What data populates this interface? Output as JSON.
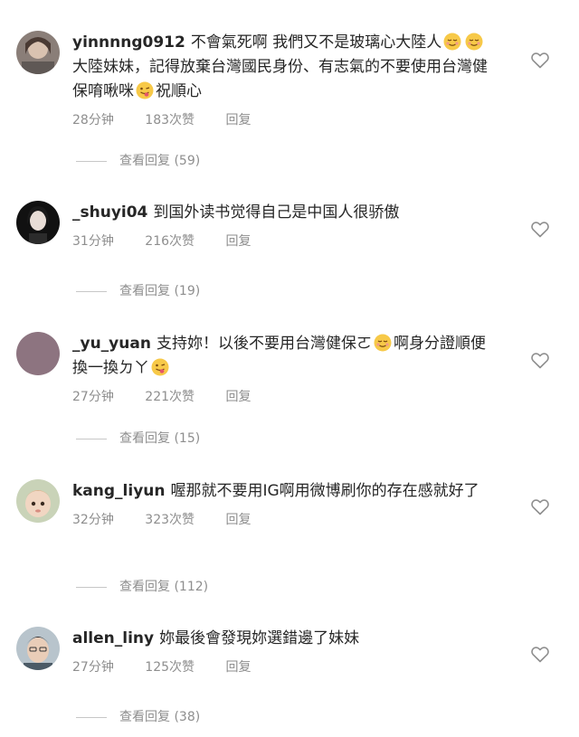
{
  "comments": [
    {
      "username": "yinnnng0912",
      "text_1": "不會氣死啊 我們又不是玻璃心大陸人",
      "text_2": "大陸妹妹，記得放棄台灣國民身份、有志氣的不要使用台灣健保唷啾咪",
      "text_3": "祝順心",
      "time": "28分钟",
      "likes": "183次赞",
      "reply": "回复",
      "view_replies": "查看回复 (59)"
    },
    {
      "username": "_shuyi04",
      "text_1": "到国外读书觉得自己是中国人很骄傲",
      "time": "31分钟",
      "likes": "216次赞",
      "reply": "回复",
      "view_replies": "查看回复 (19)"
    },
    {
      "username": "_yu_yuan",
      "text_1": "支持妳！以後不要用台灣健保ㄛ",
      "text_2": "啊身分證順便換一換ㄉㄚ",
      "time": "27分钟",
      "likes": "221次赞",
      "reply": "回复",
      "view_replies": "查看回复 (15)"
    },
    {
      "username": "kang_liyun",
      "text_1": "喔那就不要用IG啊用微博刷你的存在感就好了",
      "time": "32分钟",
      "likes": "323次赞",
      "reply": "回复",
      "view_replies": "查看回复 (112)"
    },
    {
      "username": "allen_liny",
      "text_1": "妳最後會發現妳選錯邊了妹妹",
      "time": "27分钟",
      "likes": "125次赞",
      "reply": "回复",
      "view_replies": "查看回复 (38)"
    }
  ],
  "icons": {
    "like": "heart-outline-icon",
    "emoji_smile": "relieved-face-emoji",
    "emoji_tongue": "winking-tongue-face-emoji"
  }
}
